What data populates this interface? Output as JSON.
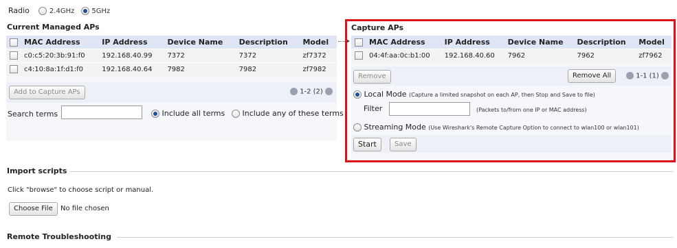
{
  "radio": {
    "label": "Radio",
    "options": [
      {
        "label": "2.4GHz",
        "selected": false
      },
      {
        "label": "5GHz",
        "selected": true
      }
    ]
  },
  "managed": {
    "title": "Current Managed APs",
    "columns": [
      "MAC Address",
      "IP Address",
      "Device Name",
      "Description",
      "Model"
    ],
    "rows": [
      {
        "mac": "c0:c5:20:3b:91:f0",
        "ip": "192.168.40.99",
        "name": "7372",
        "desc": "7372",
        "model": "zf7372"
      },
      {
        "mac": "c4:10:8a:1f:d1:f0",
        "ip": "192.168.40.64",
        "name": "7982",
        "desc": "7982",
        "model": "zf7982"
      }
    ],
    "add_button": "Add to Capture APs",
    "pager": "1-2 (2)",
    "search_label": "Search terms",
    "search_value": "",
    "include_all": "Include all terms",
    "include_any": "Include any of these terms"
  },
  "capture": {
    "title": "Capture APs",
    "columns": [
      "MAC Address",
      "IP Address",
      "Device Name",
      "Description",
      "Model"
    ],
    "rows": [
      {
        "mac": "04:4f:aa:0c:b1:00",
        "ip": "192.168.40.60",
        "name": "7962",
        "desc": "7962",
        "model": "zf7962"
      }
    ],
    "remove_button": "Remove",
    "remove_all_button": "Remove All",
    "pager": "1-1 (1)",
    "local_mode_label": "Local Mode",
    "local_mode_desc": "(Capture a limited snapshot on each AP, then Stop and Save to file)",
    "filter_label": "Filter",
    "filter_value": "",
    "filter_hint": "(Packets to/from one IP or MAC address)",
    "streaming_label": "Streaming Mode",
    "streaming_desc": "(Use Wireshark's Remote Capture Option to connect to wlan100 or wlan101)",
    "start_button": "Start",
    "save_button": "Save"
  },
  "import": {
    "title": "Import scripts",
    "instructions": "Click \"browse\" to choose script or manual.",
    "choose_button": "Choose File",
    "file_status": "No file chosen"
  },
  "remote": {
    "title": "Remote Troubleshooting"
  },
  "colors": {
    "highlight_border": "#e0101a",
    "header_bg": "#dfe5f5",
    "selected_radio": "#1f4f9a"
  }
}
